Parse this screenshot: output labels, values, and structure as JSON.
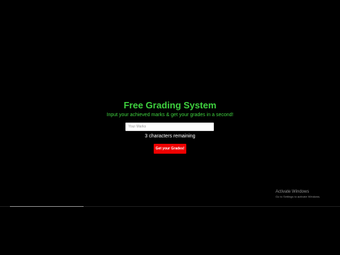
{
  "header": {
    "title": "Free Grading System",
    "subtitle": "Input your achieved marks & get your grades in a second!"
  },
  "form": {
    "marks_placeholder": "Your Marks",
    "marks_value": "",
    "remaining_text": "3 characters remaining",
    "submit_label": "Get your Grades!"
  },
  "watermark": {
    "title": "Activate Windows",
    "subtitle": "Go to Settings to activate Windows."
  },
  "colors": {
    "background": "#000000",
    "accent_green": "#3fd23f",
    "button_red": "#ee0000"
  }
}
